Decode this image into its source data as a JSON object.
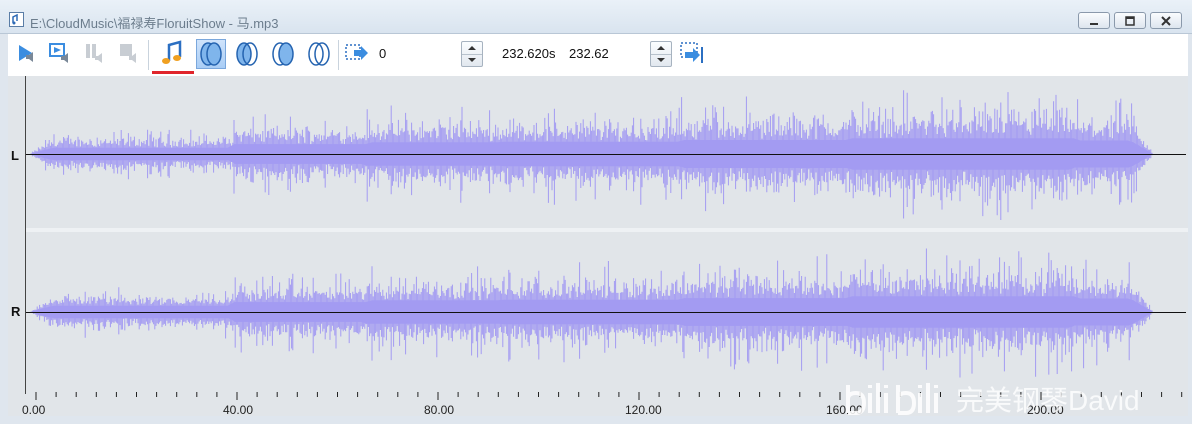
{
  "window": {
    "title": "E:\\CloudMusic\\福禄寿FloruitShow - 马.mp3"
  },
  "toolbar": {
    "start_value": "0",
    "duration_text": "232.620s",
    "end_value": "232.62"
  },
  "channels": {
    "left": "L",
    "right": "R"
  },
  "ruler": {
    "labels": [
      "0.00",
      "40.00",
      "80.00",
      "120.00",
      "160.00",
      "200.00"
    ]
  },
  "watermark": {
    "text": "完美钢琴David"
  },
  "colors": {
    "waveform": "#a39bf2",
    "selected_button": "#a9cdf5",
    "underline": "#e0252b"
  }
}
